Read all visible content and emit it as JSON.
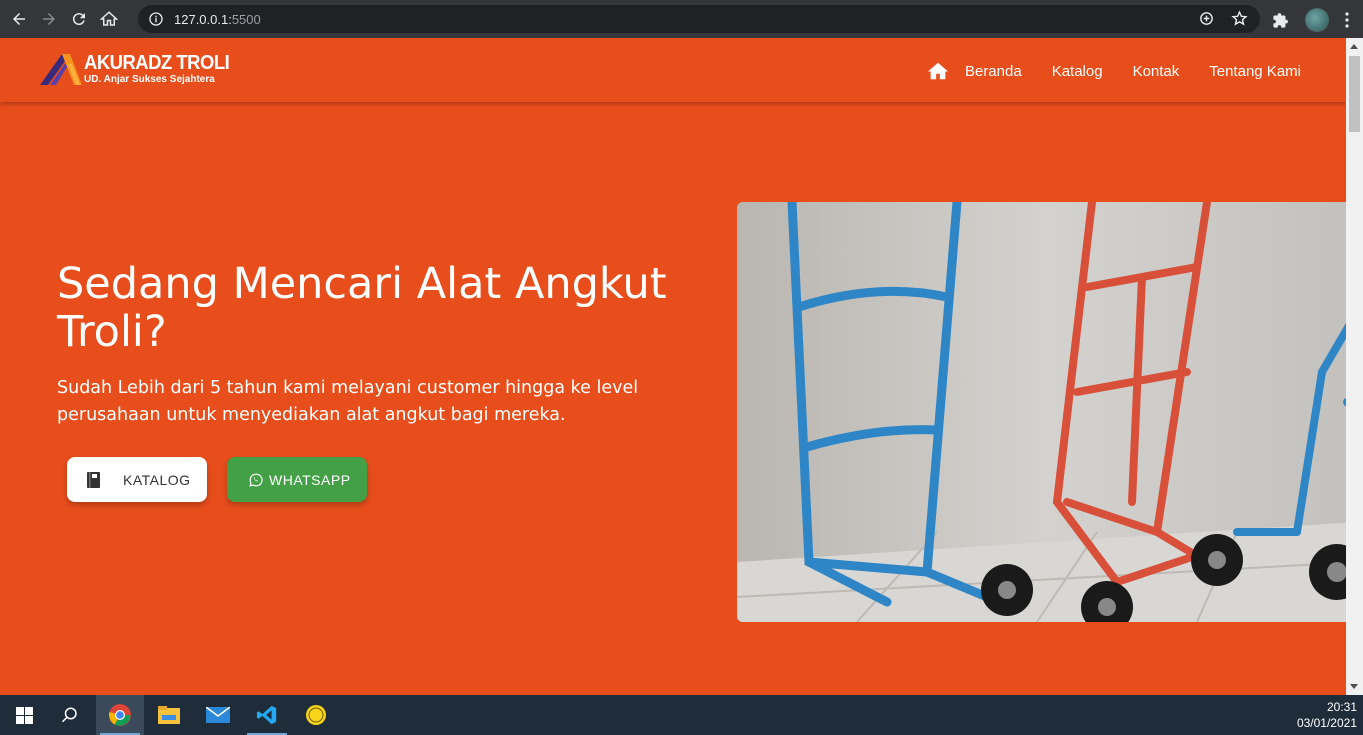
{
  "browser": {
    "url_host": "127.0.0.1:",
    "url_port": "5500"
  },
  "site": {
    "logo_title": "AKURADZ TROLI",
    "logo_subtitle": "UD. Anjar Sukses Sejahtera",
    "nav": [
      "Beranda",
      "Katalog",
      "Kontak",
      "Tentang Kami"
    ]
  },
  "hero": {
    "title": "Sedang Mencari Alat Angkut Troli?",
    "description": "Sudah Lebih dari 5 tahun kami melayani customer hingga ke level perusahaan untuk menyediakan alat angkut bagi mereka.",
    "btn_katalog": "KATALOG",
    "btn_whatsapp": "WHATSAPP"
  },
  "taskbar": {
    "time": "20:31",
    "date": "03/01/2021"
  },
  "colors": {
    "brand": "#e84e1b",
    "whatsapp": "#43a047"
  }
}
